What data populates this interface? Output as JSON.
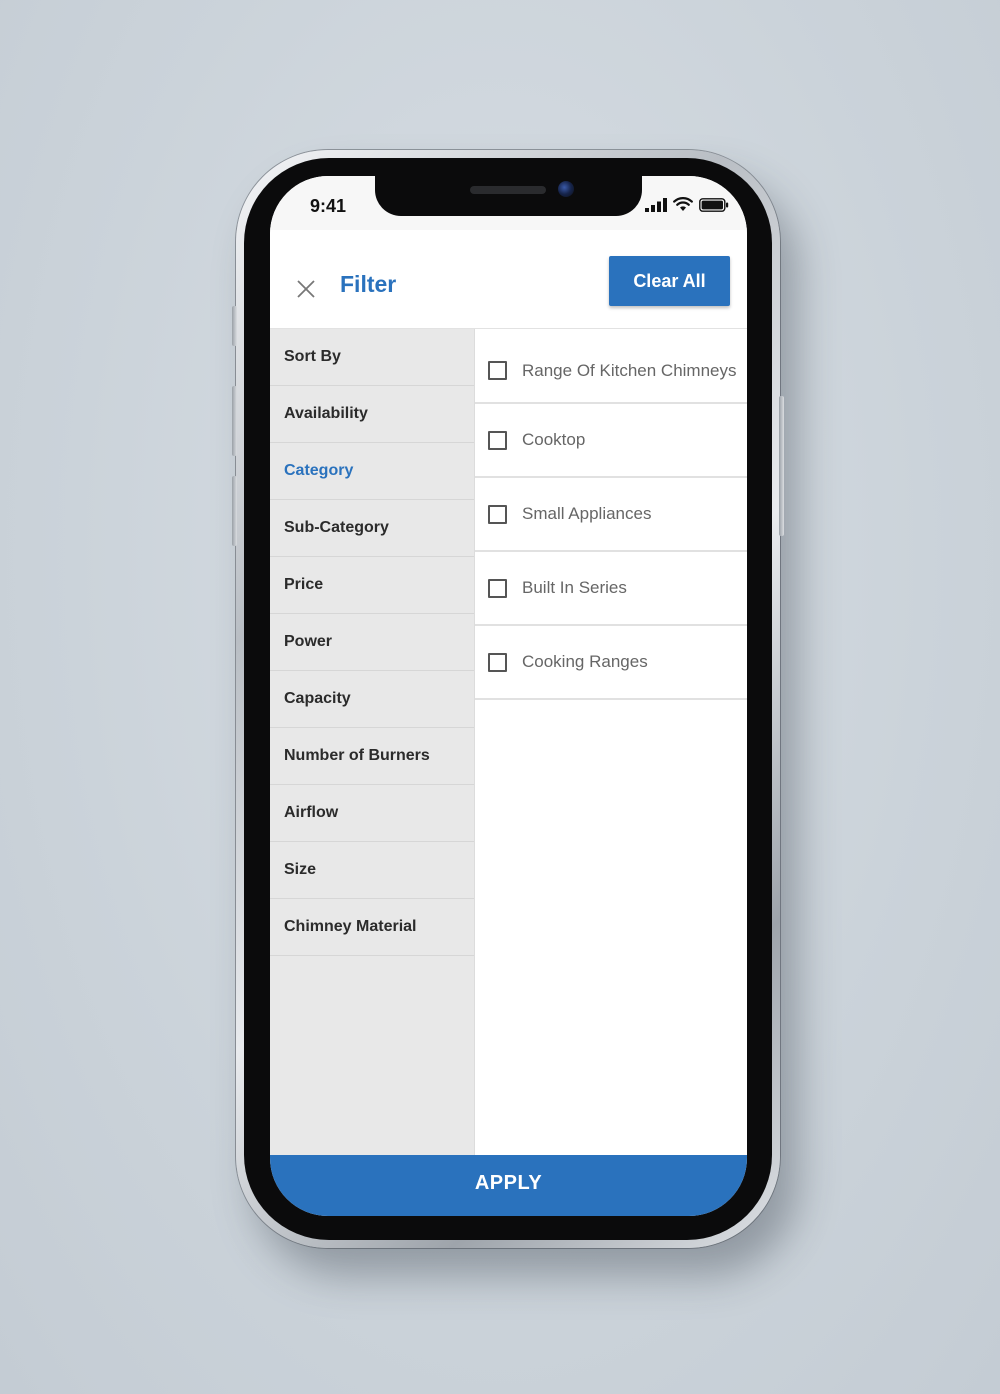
{
  "status_bar": {
    "time": "9:41"
  },
  "header": {
    "title": "Filter",
    "close_icon": "close-icon",
    "clear_all_label": "Clear All"
  },
  "menu": {
    "items": [
      {
        "label": "Sort By",
        "active": false
      },
      {
        "label": "Availability",
        "active": false
      },
      {
        "label": "Category",
        "active": true
      },
      {
        "label": "Sub-Category",
        "active": false
      },
      {
        "label": "Price",
        "active": false
      },
      {
        "label": "Power",
        "active": false
      },
      {
        "label": "Capacity",
        "active": false
      },
      {
        "label": "Number of Burners",
        "active": false
      },
      {
        "label": "Airflow",
        "active": false
      },
      {
        "label": "Size",
        "active": false
      },
      {
        "label": "Chimney Material",
        "active": false
      }
    ]
  },
  "options": {
    "items": [
      {
        "label": "Range Of Kitchen Chimneys",
        "checked": false
      },
      {
        "label": "Cooktop",
        "checked": false
      },
      {
        "label": "Small Appliances",
        "checked": false
      },
      {
        "label": "Built In Series",
        "checked": false
      },
      {
        "label": "Cooking Ranges",
        "checked": false
      }
    ]
  },
  "footer": {
    "apply_label": "APPLY"
  },
  "colors": {
    "accent": "#2a72bd",
    "menu_background": "#e8e8e8",
    "text_dark": "#2b2b2b",
    "option_text": "#666666"
  }
}
